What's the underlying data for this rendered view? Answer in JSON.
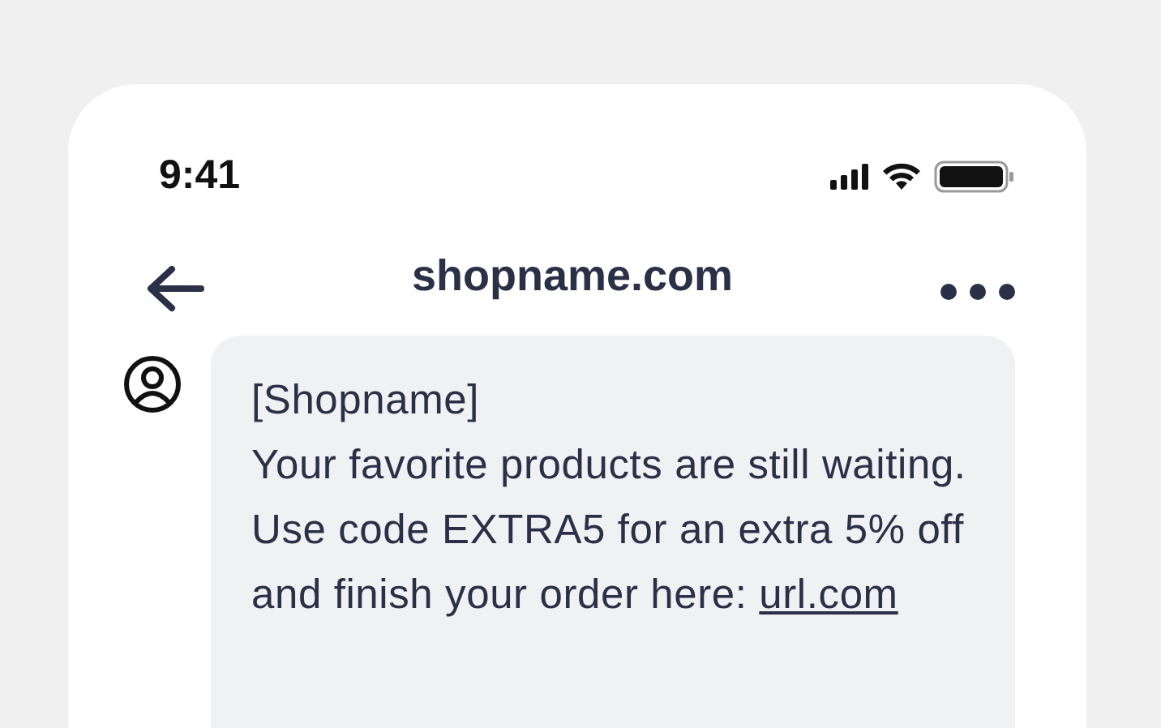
{
  "status_bar": {
    "time": "9:41"
  },
  "header": {
    "title": "shopname.com"
  },
  "message": {
    "sender": "[Shopname]",
    "text": "Your favorite products are still waiting. Use code EXTRA5 for an extra 5% off and finish your order here:",
    "link": "url.com"
  }
}
